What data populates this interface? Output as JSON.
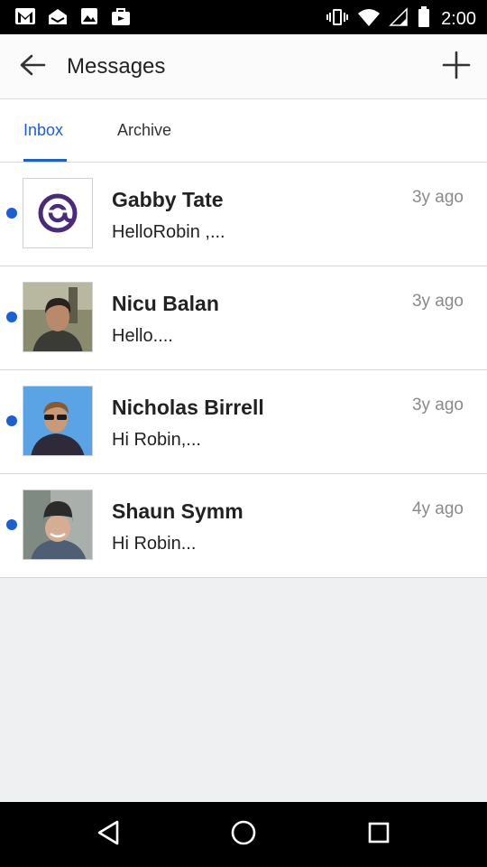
{
  "status_bar": {
    "time": "2:00",
    "left_icons": [
      "gmail-icon",
      "inbox-icon",
      "gallery-icon",
      "bag-icon"
    ],
    "right_icons": [
      "vibrate-icon",
      "wifi-icon",
      "signal-icon",
      "battery-icon"
    ]
  },
  "header": {
    "title": "Messages",
    "back_icon": "arrow-left-icon",
    "add_icon": "plus-icon"
  },
  "tabs": [
    {
      "label": "Inbox",
      "active": true
    },
    {
      "label": "Archive",
      "active": false
    }
  ],
  "messages": [
    {
      "sender": "Gabby Tate",
      "preview": "HelloRobin ,...",
      "time": "3y ago",
      "unread": true,
      "avatar": "logo-avatar"
    },
    {
      "sender": "Nicu Balan",
      "preview": "Hello....",
      "time": "3y ago",
      "unread": true,
      "avatar": "photo-avatar"
    },
    {
      "sender": "Nicholas Birrell",
      "preview": "Hi Robin,...",
      "time": "3y ago",
      "unread": true,
      "avatar": "photo-avatar"
    },
    {
      "sender": "Shaun Symm",
      "preview": "Hi Robin...",
      "time": "4y ago",
      "unread": true,
      "avatar": "photo-avatar"
    }
  ],
  "colors": {
    "accent": "#1a5fd8",
    "status_bar": "#000000",
    "background": "#eff0f1"
  },
  "nav": [
    "back-triangle-icon",
    "home-circle-icon",
    "recents-square-icon"
  ]
}
